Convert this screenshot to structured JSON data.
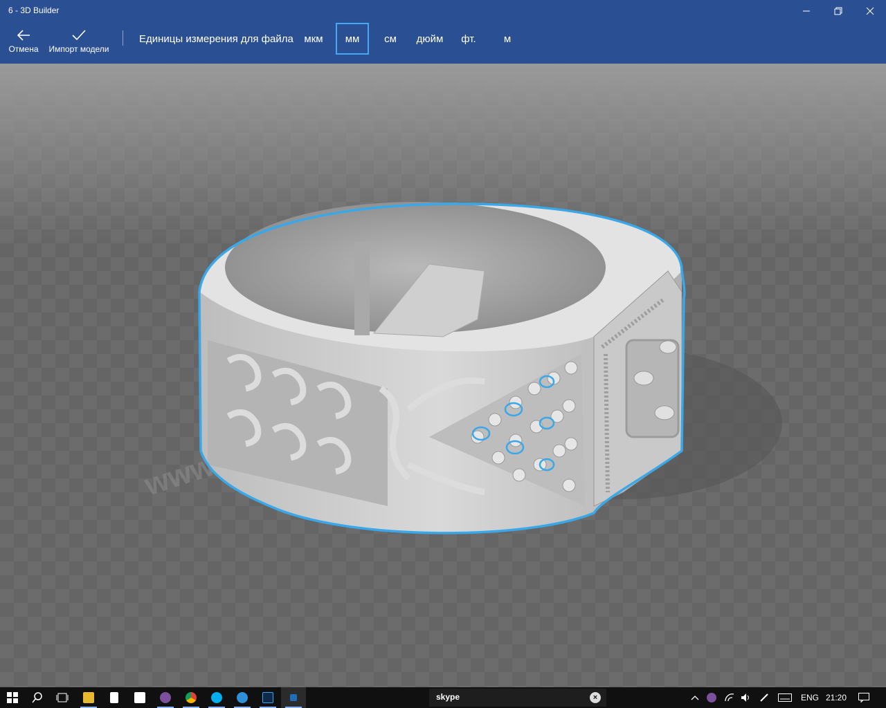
{
  "window": {
    "title": "6 - 3D Builder"
  },
  "toolbar": {
    "cancel_label": "Отмена",
    "import_label": "Импорт модели",
    "units_label": "Единицы измерения для файла",
    "units": [
      "мкм",
      "мм",
      "см",
      "дюйм",
      "фт.",
      "м"
    ],
    "selected_unit": "мм"
  },
  "colors": {
    "chrome": "#2b4f93",
    "selection_outline": "#3aa8e8",
    "viewport": "#6c6c6c",
    "taskbar": "#101010"
  },
  "taskbar": {
    "search_app_label": "skype",
    "pinned_icons": [
      "start-icon",
      "search-icon",
      "task-view-icon",
      "file-explorer-icon",
      "calculator-icon",
      "store-icon",
      "viber-icon",
      "chrome-icon",
      "skype-icon",
      "browser-icon",
      "photoshop-icon",
      "3d-builder-icon"
    ],
    "language": "ENG",
    "time": "21:20"
  }
}
